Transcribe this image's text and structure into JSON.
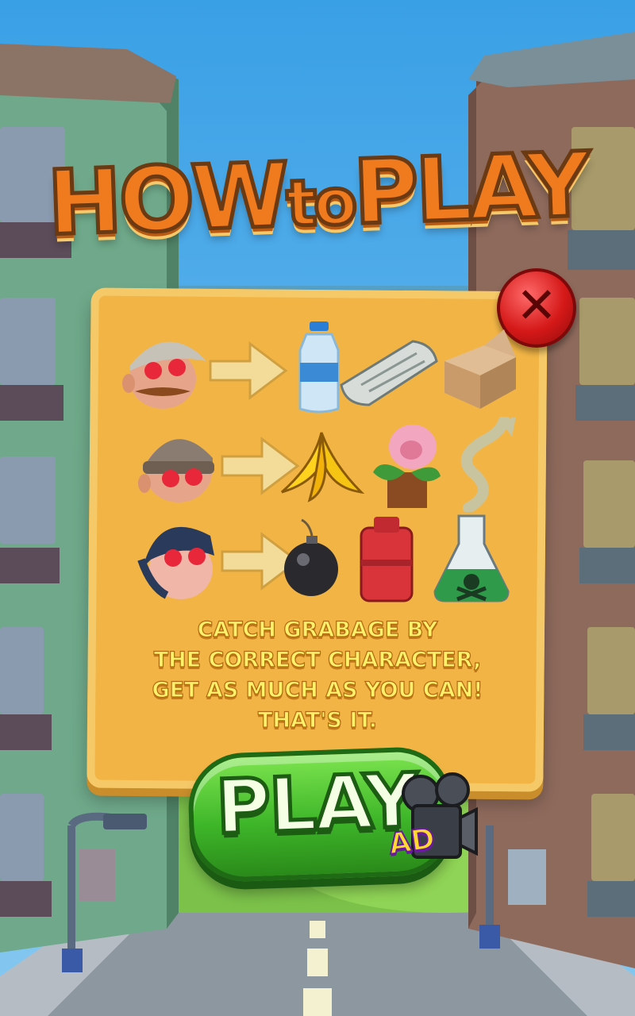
{
  "title": {
    "big": "HOW",
    "small": "to",
    "end": "PLAY"
  },
  "close_icon": "close-x-icon",
  "rules": [
    {
      "character": "cap-guy-character",
      "items": [
        "water-bottle-icon",
        "newspaper-icon",
        "cardboard-box-icon"
      ]
    },
    {
      "character": "beanie-guy-character",
      "items": [
        "banana-peel-icon",
        "flower-pot-icon",
        "fish-bone-icon"
      ]
    },
    {
      "character": "firefighter-character",
      "items": [
        "bomb-icon",
        "gas-canister-icon",
        "poison-flask-icon"
      ]
    }
  ],
  "instructions": {
    "line1": "CATCH GRABAGE BY",
    "line2": "THE CORRECT CHARACTER,",
    "line3": "GET AS MUCH AS YOU CAN!",
    "line4": "THAT'S IT."
  },
  "play_button": {
    "label": "PLAY",
    "ad_label": "AD",
    "ad_icon": "film-camera-icon"
  },
  "colors": {
    "sky": "#49a8e8",
    "panel": "#f2b545",
    "play_green": "#3fb72a",
    "close_red": "#d51818"
  }
}
